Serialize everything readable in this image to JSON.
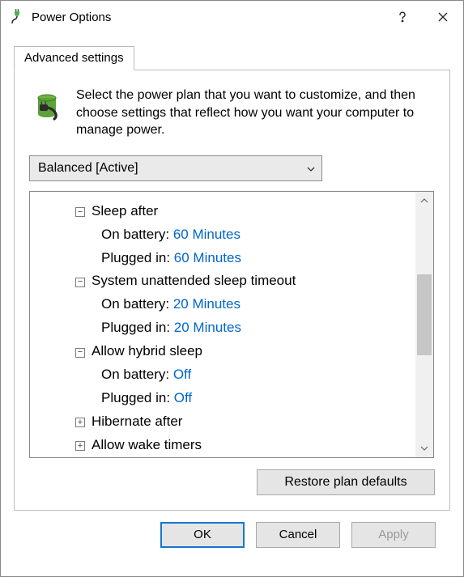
{
  "window": {
    "title": "Power Options",
    "app_icon": "power-plug-icon"
  },
  "tab": {
    "label": "Advanced settings"
  },
  "intro": "Select the power plan that you want to customize, and then choose settings that reflect how you want your computer to manage power.",
  "plan_selected": "Balanced [Active]",
  "tree": {
    "items": [
      {
        "kind": "group",
        "expanded": true,
        "label": "Sleep after"
      },
      {
        "kind": "setting",
        "label": "On battery",
        "value": "60 Minutes"
      },
      {
        "kind": "setting",
        "label": "Plugged in",
        "value": "60 Minutes"
      },
      {
        "kind": "group",
        "expanded": true,
        "label": "System unattended sleep timeout"
      },
      {
        "kind": "setting",
        "label": "On battery",
        "value": "20 Minutes"
      },
      {
        "kind": "setting",
        "label": "Plugged in",
        "value": "20 Minutes"
      },
      {
        "kind": "group",
        "expanded": true,
        "label": "Allow hybrid sleep"
      },
      {
        "kind": "setting",
        "label": "On battery",
        "value": "Off"
      },
      {
        "kind": "setting",
        "label": "Plugged in",
        "value": "Off"
      },
      {
        "kind": "group",
        "expanded": false,
        "label": "Hibernate after"
      },
      {
        "kind": "group",
        "expanded": false,
        "label": "Allow wake timers"
      }
    ]
  },
  "buttons": {
    "restore": "Restore plan defaults",
    "ok": "OK",
    "cancel": "Cancel",
    "apply": "Apply"
  }
}
